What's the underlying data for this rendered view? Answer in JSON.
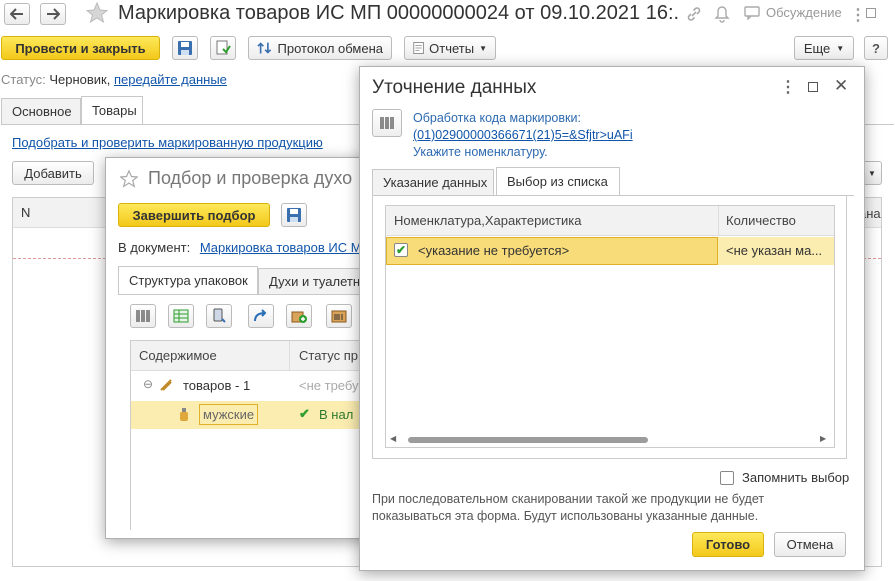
{
  "main": {
    "title": "Маркировка товаров ИС МП 00000000024 от 09.10.2021 16:...",
    "discussion_label": "Обсуждение",
    "toolbar": {
      "post_close_label": "Провести и закрыть",
      "exchange_protocol_label": "Протокол обмена",
      "reports_label": "Отчеты",
      "more_label": "Еще"
    },
    "status_prefix": "Статус:",
    "status_value": "Черновик,",
    "status_link": "передайте данные",
    "tabs": [
      "Основное",
      "Товары"
    ],
    "select_check_link": "Подобрать и проверить маркированную продукцию",
    "add_label": "Добавить",
    "col_n": "N",
    "col_right_fragment": "ана"
  },
  "picker": {
    "title": "Подбор и проверка духо",
    "finish_label": "Завершить подбор",
    "doc_label": "В документ:",
    "doc_link": "Маркировка товаров ИС М",
    "tabs": [
      "Структура упаковок",
      "Духи и туалетн"
    ],
    "col_content": "Содержимое",
    "col_status": "Статус пр",
    "rows": [
      {
        "name": "товаров - 1",
        "status": "<не требу"
      },
      {
        "name": "мужские",
        "status": "В нал"
      }
    ]
  },
  "dialog": {
    "title": "Уточнение данных",
    "processing_label": "Обработка кода маркировки:",
    "code_link": "(01)02900000366671(21)5=&Sfjtr>uAFi",
    "hint": "Укажите номенклатуру.",
    "tabs": [
      "Указание данных",
      "Выбор из списка"
    ],
    "col_nomenclature": "Номенклатура,Характеристика",
    "col_quantity": "Количество",
    "row": {
      "nomenclature": "<указание не требуется>",
      "quantity": "<не указан ма..."
    },
    "remember_label": "Запомнить выбор",
    "note": "При последовательном сканировании такой же продукции не будет показываться эта форма. Будут использованы указанные данные.",
    "ok_label": "Готово",
    "cancel_label": "Отмена"
  },
  "colors": {
    "accent_yellow": "#f3c81a",
    "link_blue": "#1155aa",
    "selection_yellow": "#fbecb0",
    "check_green": "#2e9e2e"
  }
}
